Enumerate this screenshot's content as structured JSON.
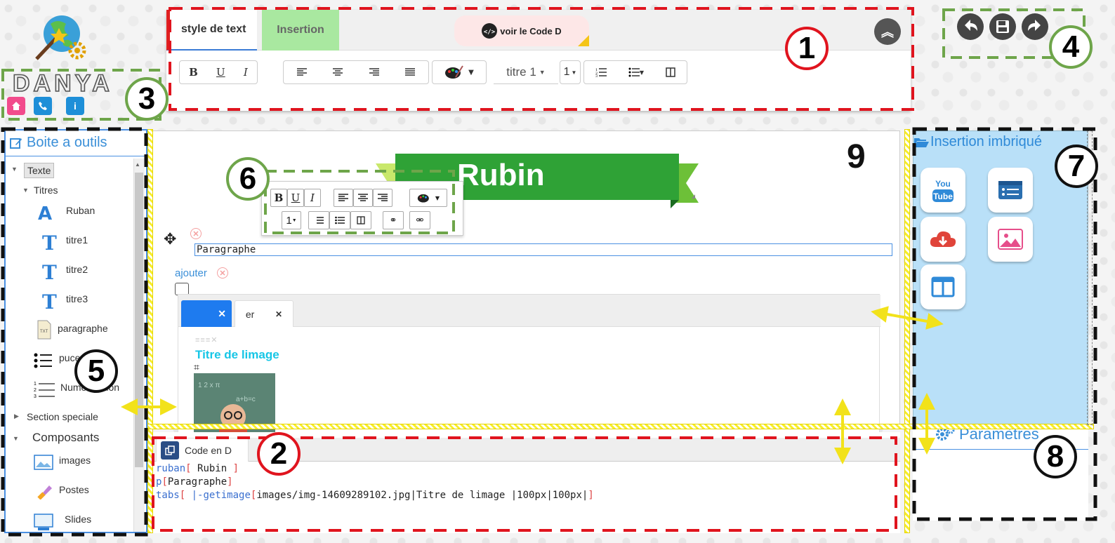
{
  "logo": {
    "text": "DANYA",
    "buttons": [
      "home-icon",
      "phone-icon",
      "info-icon"
    ]
  },
  "toolbar": {
    "tabs": [
      {
        "label": "style de text"
      },
      {
        "label": "Insertion"
      }
    ],
    "voir_code_label": "voir le Code D",
    "bold": "B",
    "underline": "U",
    "italic": "I",
    "heading_select": "titre 1",
    "size_select": "1"
  },
  "left_panel": {
    "title": "Boite a outils",
    "texte": "Texte",
    "titres": "Titres",
    "items": [
      "Ruban",
      "titre1",
      "titre2",
      "titre3",
      "paragraphe",
      "puce",
      "Numérotation"
    ],
    "section_speciale": "Section speciale",
    "composants": "Composants",
    "comp_items": [
      "images",
      "Postes",
      "Slides"
    ]
  },
  "canvas": {
    "ribbon_text": "Rubin",
    "paragraph_value": "Paragraphe",
    "ajouter": "ajouter",
    "tab_b_label": "er",
    "image_title": "Titre de limage"
  },
  "float_toolbar": {
    "bold": "B",
    "underline": "U",
    "italic": "I",
    "size": "1"
  },
  "right_panel": {
    "title": "Insertion imbriqué",
    "params_title": "Paramètres"
  },
  "code": {
    "tab_label": "Code en D",
    "line1": {
      "kw": "ruban",
      "b1": "[",
      "txt": " Rubin ",
      "b2": "]"
    },
    "line2": {
      "kw": "p",
      "b1": "[",
      "txt": "Paragraphe",
      "b2": "]"
    },
    "line3": {
      "kw": "tabs",
      "b1": "[",
      "sep": "    |",
      "fn": "-getimage",
      "b3": "[",
      "txt": "images/img-14609289102.jpg|Titre de limage |100px|100px|",
      "b4": "]"
    }
  },
  "annotations": [
    "1",
    "2",
    "3",
    "4",
    "5",
    "6",
    "7",
    "8",
    "9"
  ]
}
